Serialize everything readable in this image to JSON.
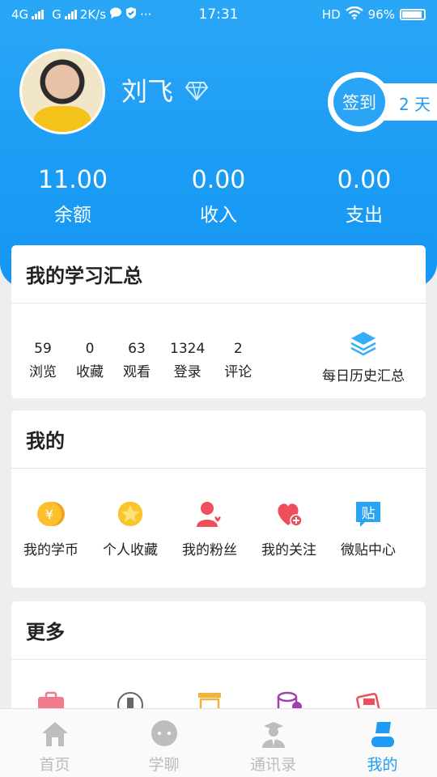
{
  "status_bar": {
    "network_1": "4G",
    "network_2": "G",
    "speed": "2K/s",
    "more": "···",
    "time": "17:31",
    "hd": "HD",
    "battery": "96%"
  },
  "profile": {
    "name": "刘飞",
    "signin_label": "签到",
    "signin_days": "2 天"
  },
  "stats": [
    {
      "value": "11.00",
      "label": "余额"
    },
    {
      "value": "0.00",
      "label": "收入"
    },
    {
      "value": "0.00",
      "label": "支出"
    }
  ],
  "summary": {
    "title": "我的学习汇总",
    "counts": [
      {
        "value": "59",
        "label": "浏览"
      },
      {
        "value": "0",
        "label": "收藏"
      },
      {
        "value": "63",
        "label": "观看"
      },
      {
        "value": "1324",
        "label": "登录"
      },
      {
        "value": "2",
        "label": "评论"
      }
    ],
    "history_label": "每日历史汇总"
  },
  "mine": {
    "title": "我的",
    "items": [
      {
        "label": "我的学币",
        "icon": "coin-icon"
      },
      {
        "label": "个人收藏",
        "icon": "star-icon"
      },
      {
        "label": "我的粉丝",
        "icon": "fans-icon"
      },
      {
        "label": "我的关注",
        "icon": "heart-plus-icon"
      },
      {
        "label": "微贴中心",
        "icon": "post-icon"
      }
    ]
  },
  "more": {
    "title": "更多",
    "icons": [
      "briefcase-icon",
      "building-icon",
      "document-icon",
      "database-icon",
      "ticket-icon"
    ]
  },
  "tabs": [
    {
      "label": "首页",
      "icon": "home-icon",
      "active": false
    },
    {
      "label": "学聊",
      "icon": "chat-icon",
      "active": false
    },
    {
      "label": "通讯录",
      "icon": "contacts-icon",
      "active": false
    },
    {
      "label": "我的",
      "icon": "person-icon",
      "active": true
    }
  ],
  "colors": {
    "brand_blue": "#1f9bf4",
    "header_blue": "#2aa6f6",
    "inactive_tab": "#bbbbbb"
  }
}
